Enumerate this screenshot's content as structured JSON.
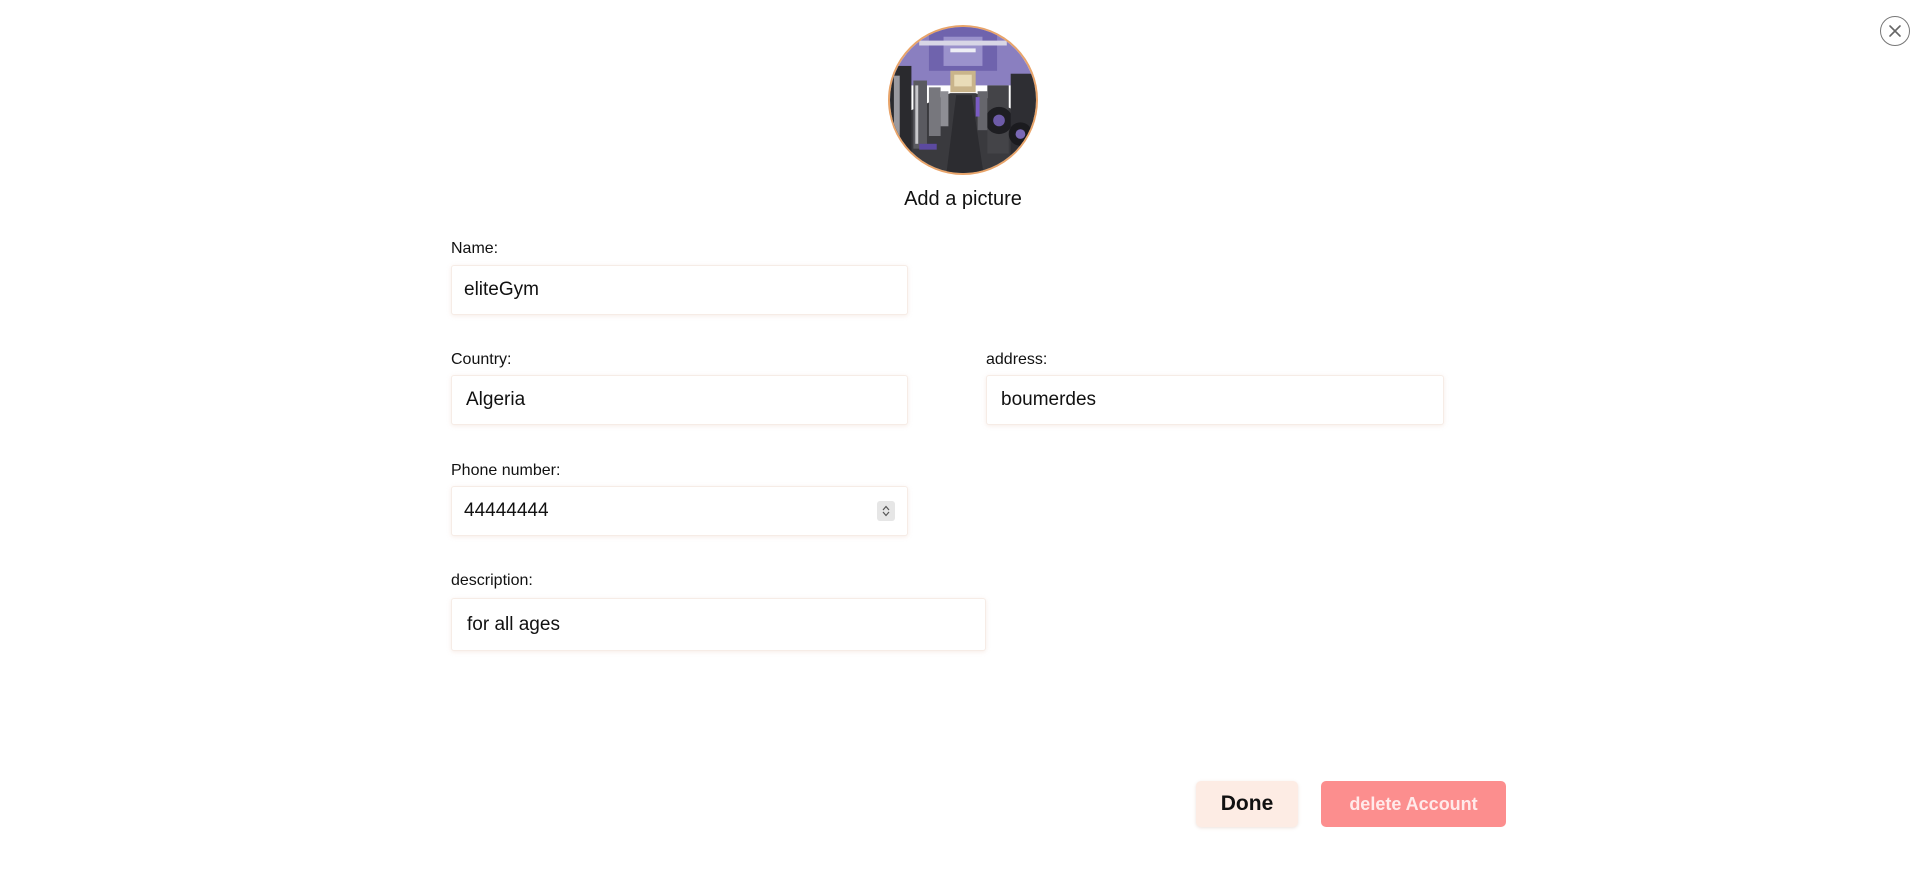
{
  "profile": {
    "add_picture_label": "Add a picture"
  },
  "form": {
    "name": {
      "label": "Name:",
      "value": "eliteGym"
    },
    "country": {
      "label": "Country:",
      "value": "Algeria"
    },
    "address": {
      "label": "address:",
      "value": "boumerdes"
    },
    "phone": {
      "label": "Phone number:",
      "value": "44444444"
    },
    "description": {
      "label": "description:",
      "value": "for all ages"
    }
  },
  "actions": {
    "done_label": "Done",
    "delete_label": "delete Account"
  },
  "colors": {
    "done_bg": "#fdece4",
    "delete_bg": "#fc8e8e",
    "avatar_border": "#e8a46a"
  },
  "icons": {
    "close": "close-icon",
    "avatar": "gym-photo"
  }
}
